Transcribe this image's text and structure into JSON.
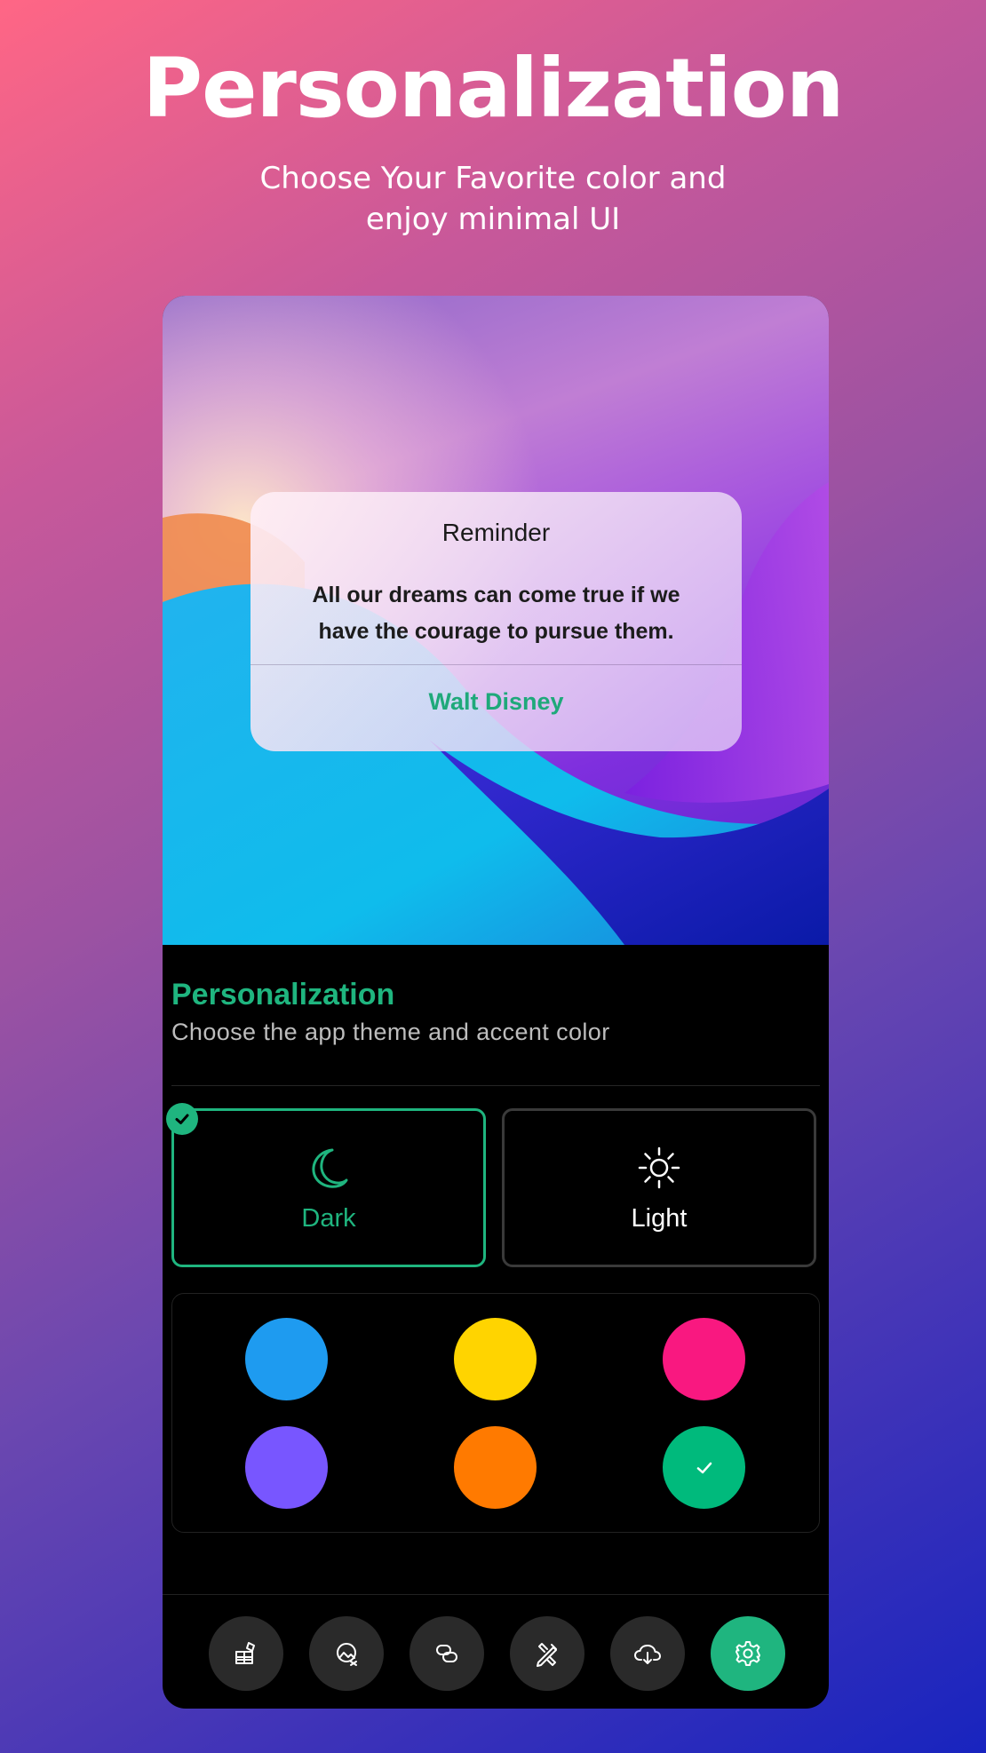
{
  "header": {
    "title": "Personalization",
    "subtitle": "Choose Your Favorite color and enjoy minimal UI"
  },
  "dialog": {
    "title": "Reminder",
    "message": "All our dreams can come true if we have the courage to pursue them.",
    "action": "Walt Disney"
  },
  "settings": {
    "title": "Personalization",
    "subtitle": "Choose the app theme and accent color",
    "themes": [
      {
        "label": "Dark",
        "icon": "moon-icon",
        "selected": true
      },
      {
        "label": "Light",
        "icon": "sun-icon",
        "selected": false
      }
    ],
    "accent_colors": [
      {
        "name": "blue",
        "hex": "#1e9bf0",
        "selected": false
      },
      {
        "name": "yellow",
        "hex": "#ffd400",
        "selected": false
      },
      {
        "name": "pink",
        "hex": "#f91880",
        "selected": false
      },
      {
        "name": "purple",
        "hex": "#7856ff",
        "selected": false
      },
      {
        "name": "orange",
        "hex": "#ff7a00",
        "selected": false
      },
      {
        "name": "green",
        "hex": "#00ba7c",
        "selected": true
      }
    ]
  },
  "bottom_nav": [
    {
      "icon": "widgets-icon",
      "active": false
    },
    {
      "icon": "wallpaper-icon",
      "active": false
    },
    {
      "icon": "link-icon",
      "active": false
    },
    {
      "icon": "design-tools-icon",
      "active": false
    },
    {
      "icon": "cloud-download-icon",
      "active": false
    },
    {
      "icon": "settings-gear-icon",
      "active": true
    }
  ],
  "colors": {
    "accent": "#1fb57f",
    "background": "#000000"
  }
}
